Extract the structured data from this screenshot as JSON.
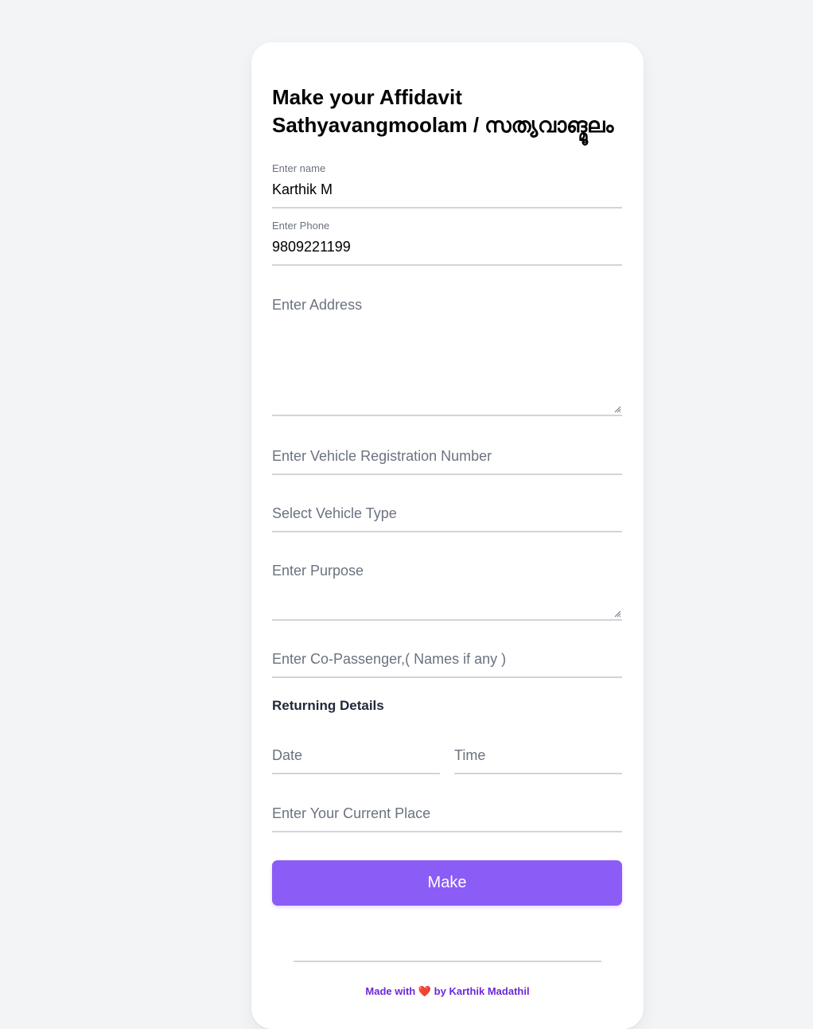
{
  "form": {
    "title_line1": "Make your Affidavit",
    "title_line2": "Sathyavangmoolam / സത്യവാങ്മൂലം",
    "name": {
      "label": "Enter name",
      "value": "Karthik M"
    },
    "phone": {
      "label": "Enter Phone",
      "value": "9809221199"
    },
    "address": {
      "placeholder": "Enter Address"
    },
    "vehicle_reg": {
      "placeholder": "Enter Vehicle Registration Number"
    },
    "vehicle_type": {
      "placeholder": "Select Vehicle Type"
    },
    "purpose": {
      "placeholder": "Enter Purpose"
    },
    "co_passenger": {
      "placeholder": "Enter Co-Passenger,( Names if any )"
    },
    "returning_title": "Returning Details",
    "date": {
      "placeholder": "Date"
    },
    "time": {
      "placeholder": "Time"
    },
    "current_place": {
      "placeholder": "Enter Your Current Place"
    },
    "submit_label": "Make"
  },
  "footer": {
    "prefix": "Made with",
    "heart": "❤️",
    "suffix": "by Karthik Madathil"
  },
  "colors": {
    "accent": "#8b5cf6",
    "footer_text": "#6d28d9",
    "background": "#f3f4f6"
  }
}
